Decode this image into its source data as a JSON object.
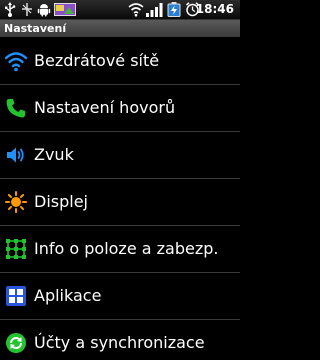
{
  "status_bar": {
    "time": "18:46",
    "icons": [
      "usb-icon",
      "usb-debug-icon",
      "android-icon",
      "picture-notification-icon",
      "wifi-icon",
      "signal-icon",
      "battery-icon",
      "alarm-icon"
    ]
  },
  "title_bar": {
    "title": "Nastavení"
  },
  "settings": {
    "items": [
      {
        "label": "Bezdrátové sítě",
        "icon": "wifi-icon",
        "color": "#1e90ff"
      },
      {
        "label": "Nastavení hovorů",
        "icon": "phone-icon",
        "color": "#22c32e"
      },
      {
        "label": "Zvuk",
        "icon": "speaker-icon",
        "color": "#1e90ff"
      },
      {
        "label": "Displej",
        "icon": "sun-icon",
        "color": "#ff9a00"
      },
      {
        "label": "Info o poloze a zabezp.",
        "icon": "pattern-lock-icon",
        "color": "#22c32e"
      },
      {
        "label": "Aplikace",
        "icon": "applications-grid-icon",
        "color": "#2a56d6"
      },
      {
        "label": "Účty a synchronizace",
        "icon": "sync-icon",
        "color": "#22c32e"
      }
    ]
  }
}
